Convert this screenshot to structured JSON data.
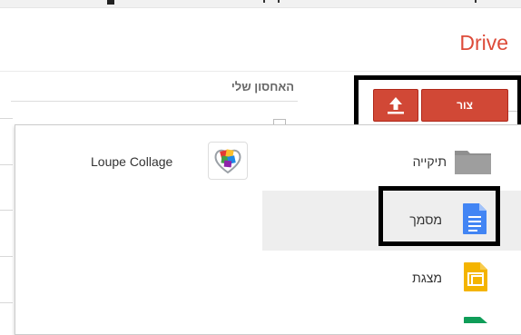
{
  "app": {
    "title": "Drive"
  },
  "sidebar": {
    "storage_label": "האחסון שלי"
  },
  "toolbar": {
    "create_label": "צור",
    "upload_icon": "upload-icon"
  },
  "new_menu": {
    "items": [
      {
        "label": "Loupe Collage",
        "icon": "loupe-collage-icon"
      },
      {
        "label": "תיקייה",
        "icon": "folder-icon"
      },
      {
        "label": "מסמך",
        "icon": "document-icon",
        "highlighted": true
      },
      {
        "label": "מצגת",
        "icon": "presentation-icon"
      }
    ]
  },
  "colors": {
    "brand_red": "#dd4b39",
    "button_red": "#d14836",
    "docs_blue": "#4285f4",
    "slides_yellow": "#f4b400",
    "sheets_green": "#0f9d58",
    "folder_gray": "#8f8f8f",
    "highlight_gray": "#eeeeee"
  }
}
